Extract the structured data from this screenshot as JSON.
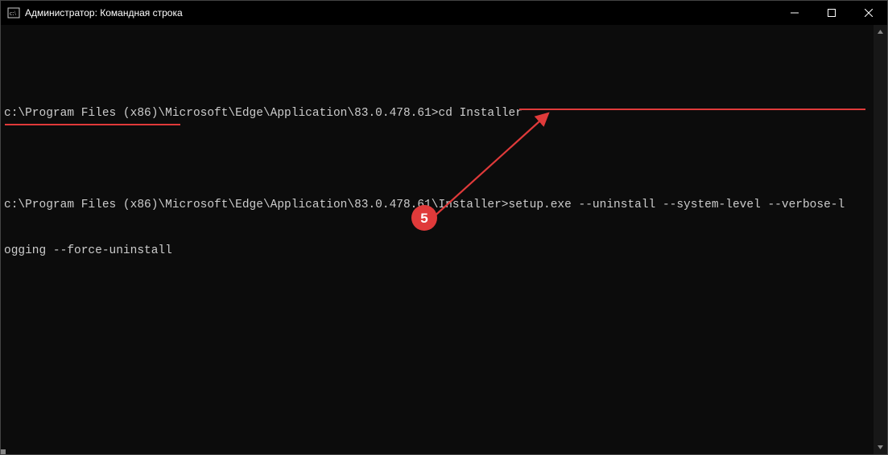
{
  "window": {
    "title": "Администратор: Командная строка"
  },
  "terminal": {
    "line1_prompt": "c:\\Program Files (x86)\\Microsoft\\Edge\\Application\\83.0.478.61>",
    "line1_cmd": "cd Installer",
    "line2_prompt": "c:\\Program Files (x86)\\Microsoft\\Edge\\Application\\83.0.478.61\\Installer>",
    "line2_cmd_part1": "setup.exe --uninstall --system-level --verbose-l",
    "line2_cmd_part2": "ogging --force-uninstall"
  },
  "annotation": {
    "badge": "5",
    "color": "#e03a3a"
  }
}
